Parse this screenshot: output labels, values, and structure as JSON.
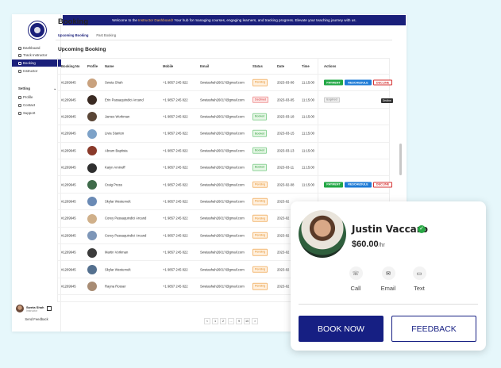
{
  "banner": {
    "prefix": "Welcome to the ",
    "highlight": "Instructor Dashboard!",
    "suffix": " Your hub for managing courses, engaging learners, and tracking progress. Elevate your teaching journey with us."
  },
  "sidebar": {
    "items": [
      "Dashboard",
      "Track Instructor",
      "Booking",
      "Instructor"
    ],
    "section": "Setting",
    "settings": [
      "Profile",
      "Contact",
      "Support"
    ],
    "user_name": "Sweta Shah",
    "user_role": "Instructor",
    "send_feedback": "Send Feedback"
  },
  "page": {
    "title": "Booking",
    "tabs": [
      "Upcoming Booking",
      "Past Booking"
    ],
    "section_title": "Upcoming Booking"
  },
  "table": {
    "headers": [
      "Booking No",
      "Profile",
      "Name",
      "Mobile",
      "Email",
      "Status",
      "Date",
      "Time",
      "Actions"
    ],
    "rows": [
      {
        "no": "#1269945",
        "name": "Sweta Shah",
        "mobile": "+1 9857 245 822",
        "email": "Swetashah2601?@gmail.com",
        "status": "Pending",
        "date": "2023-03-06",
        "time": "11:15:00",
        "actions": [
          "PAYMENT",
          "RESCHEDULE",
          "DECLINE"
        ]
      },
      {
        "no": "#1269945",
        "name": "Erin Passaquindici Arcand",
        "mobile": "+1 9857 245 822",
        "email": "Swetashah2601?@gmail.com",
        "status": "Declined",
        "date": "2023-03-05",
        "time": "11:15:00",
        "actions": [
          "Expired"
        ]
      },
      {
        "no": "#1269945",
        "name": "James Workman",
        "mobile": "+1 9857 245 822",
        "email": "Swetashah2601?@gmail.com",
        "status": "Booked",
        "date": "2023-03-18",
        "time": "11:15:00",
        "actions": []
      },
      {
        "no": "#1269945",
        "name": "Livia Stanton",
        "mobile": "+1 9857 245 822",
        "email": "Swetashah2601?@gmail.com",
        "status": "Booked",
        "date": "2023-03-15",
        "time": "11:15:00",
        "actions": []
      },
      {
        "no": "#1269945",
        "name": "Abram Baptista",
        "mobile": "+1 9857 245 822",
        "email": "Swetashah2601?@gmail.com",
        "status": "Booked",
        "date": "2023-03-13",
        "time": "11:15:00",
        "actions": []
      },
      {
        "no": "#1269945",
        "name": "Kaiyn Aminoff",
        "mobile": "+1 9857 245 822",
        "email": "Swetashah2601?@gmail.com",
        "status": "Booked",
        "date": "2023-03-11",
        "time": "11:15:00",
        "actions": []
      },
      {
        "no": "#1269945",
        "name": "Craig Press",
        "mobile": "+1 9857 245 822",
        "email": "Swetashah2601?@gmail.com",
        "status": "Pending",
        "date": "2023-02-08",
        "time": "11:15:00",
        "actions": [
          "PAYMENT",
          "RESCHEDULE",
          "DECLINE"
        ]
      },
      {
        "no": "#1269945",
        "name": "Skylar Westervelt",
        "mobile": "+1 9857 245 822",
        "email": "Swetashah2601?@gmail.com",
        "status": "Pending",
        "date": "2023-02",
        "time": "",
        "actions": []
      },
      {
        "no": "#1269945",
        "name": "Corey Passaquindici Arcand",
        "mobile": "+1 9857 245 822",
        "email": "Swetashah2601?@gmail.com",
        "status": "Pending",
        "date": "2023-02",
        "time": "",
        "actions": []
      },
      {
        "no": "#1269945",
        "name": "Corey Passaquindici Arcand",
        "mobile": "+1 9857 245 822",
        "email": "Swetashah2601?@gmail.com",
        "status": "Pending",
        "date": "2023-02",
        "time": "",
        "actions": []
      },
      {
        "no": "#1269945",
        "name": "Martin Vorkman",
        "mobile": "+1 9857 245 822",
        "email": "Swetashah2601?@gmail.com",
        "status": "Pending",
        "date": "2023-02",
        "time": "",
        "actions": []
      },
      {
        "no": "#1269945",
        "name": "Skylar Westervelt",
        "mobile": "+1 9857 245 822",
        "email": "Swetashah2601?@gmail.com",
        "status": "Pending",
        "date": "2023-02",
        "time": "",
        "actions": []
      },
      {
        "no": "#1269945",
        "name": "Rayna Rosser",
        "mobile": "+1 9857 245 822",
        "email": "Swetashah2601?@gmail.com",
        "status": "Pending",
        "date": "2023-02",
        "time": "",
        "actions": []
      }
    ],
    "tooltip": "Decline"
  },
  "pagination": [
    "<",
    "1",
    "2",
    "...",
    "9",
    "10",
    ">"
  ],
  "card": {
    "name": "Justin Vaccaro",
    "price": "$60.00",
    "unit": "/hr",
    "actions": [
      "Call",
      "Email",
      "Text"
    ],
    "book_now": "BOOK NOW",
    "feedback": "FEEDBACK"
  },
  "colors": {
    "primary": "#1a1f7a",
    "pending": "#e38a1e",
    "booked": "#2e9e3a",
    "declined": "#d43030"
  }
}
